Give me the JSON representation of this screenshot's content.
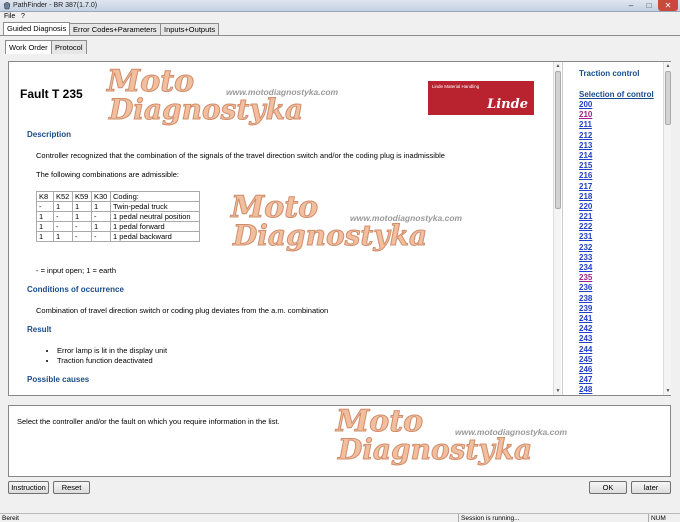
{
  "window": {
    "title": "PathFinder - BR 387(1.7.0)",
    "minimize": "–",
    "maximize": "□",
    "close": "✕"
  },
  "menu": [
    "File",
    "?"
  ],
  "tabs": [
    "Guided Diagnosis",
    "Error Codes+Parameters",
    "Inputs+Outputs"
  ],
  "subtabs": [
    "Work Order",
    "Protocol"
  ],
  "main": {
    "fault_title": "Fault T 235",
    "logo_small_text": "Linde Material Handling",
    "logo_name": "Linde",
    "description_heading": "Description",
    "description_text": "Controller recognized that the combination of the signals of the travel direction switch and/or the coding plug is inadmissible",
    "combinations_intro": "The following combinations are admissible:",
    "table_header": [
      "K8",
      "K52",
      "K59",
      "K30",
      "Coding:"
    ],
    "table_rows": [
      [
        "-",
        "1",
        "1",
        "1",
        "Twin-pedal truck"
      ],
      [
        "1",
        "-",
        "1",
        "-",
        "1 pedal neutral position"
      ],
      [
        "1",
        "-",
        "-",
        "1",
        "1 pedal forward"
      ],
      [
        "1",
        "1",
        "-",
        "-",
        "1 pedal backward"
      ]
    ],
    "legend": "- = input open; 1 = earth",
    "conditions_heading": "Conditions of occurrence",
    "conditions_text": "Combination of travel direction switch or coding plug deviates from the a.m. combination",
    "result_heading": "Result",
    "result_items": [
      "Error lamp is lit in the display unit",
      "Traction function deactivated"
    ],
    "possible_causes_heading": "Possible causes"
  },
  "watermark": {
    "line1": "Moto",
    "line2": "Diagnostyka",
    "url": "www.motodiagnostyka.com"
  },
  "side": {
    "title": "Traction control",
    "selection_link": "Selection of control",
    "faults": [
      "200",
      "210",
      "211",
      "212",
      "213",
      "214",
      "215",
      "216",
      "217",
      "218",
      "220",
      "221",
      "222",
      "231",
      "232",
      "233",
      "234",
      "235",
      "236",
      "238",
      "239",
      "241",
      "242",
      "243",
      "244",
      "245",
      "246",
      "247",
      "248",
      "249"
    ],
    "visited": [
      "210",
      "235"
    ]
  },
  "info": {
    "text": "Select the controller and/or the fault on which you require information in the list."
  },
  "buttons": {
    "instruction": "Instruction",
    "reset": "Reset",
    "ok": "OK",
    "later": "later"
  },
  "status": {
    "left": "Bereit",
    "session": "Session is running...",
    "num": "NUM"
  }
}
